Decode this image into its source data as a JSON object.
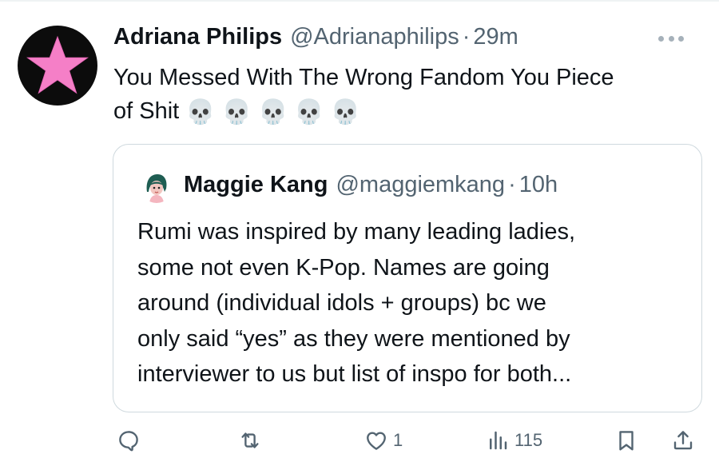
{
  "tweet": {
    "author_name": "Adriana Philips",
    "author_handle": "@Adrianaphilips",
    "separator": "·",
    "time": "29m",
    "line1": "You Messed With The Wrong Fandom You Piece",
    "line2": "of Shit",
    "emoji": "💀",
    "avatar_icon": "pink-star-icon"
  },
  "quoted": {
    "author_name": "Maggie Kang",
    "author_handle": "@maggiemkang",
    "separator": "·",
    "time": "10h",
    "lines": [
      "Rumi was inspired by many leading ladies,",
      "some not even K-Pop. Names are going",
      "around (individual idols + groups) bc we",
      "only said “yes” as they were mentioned by",
      "interviewer to us but list of inspo for both..."
    ]
  },
  "actions": {
    "replies": "",
    "retweets": "",
    "likes": "1",
    "views": "115"
  },
  "colors": {
    "text": "#0f1419",
    "secondary": "#536471",
    "border": "#cfd9de",
    "star": "#f57fc7"
  }
}
